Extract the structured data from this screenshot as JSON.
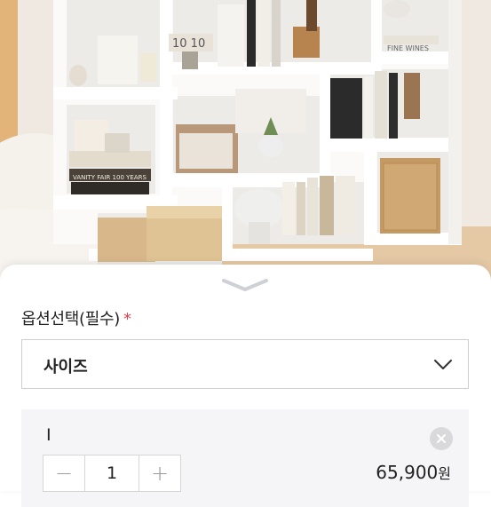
{
  "option_section": {
    "label": "옵션선택(필수)",
    "required_mark": "*"
  },
  "select": {
    "value": "사이즈"
  },
  "selected_item": {
    "name": "I",
    "quantity": "1",
    "minus": "−",
    "plus": "+",
    "price": "65,900",
    "currency": "원"
  },
  "photo_text": {
    "clock_digits": "10 10",
    "book_spine": "FINE WINES",
    "book_vanity": "VANITY FAIR 100 YEARS"
  },
  "colors": {
    "required_mark": "#e0404a",
    "shelf": "#f7f5f2",
    "wall": "#efe6dc"
  }
}
